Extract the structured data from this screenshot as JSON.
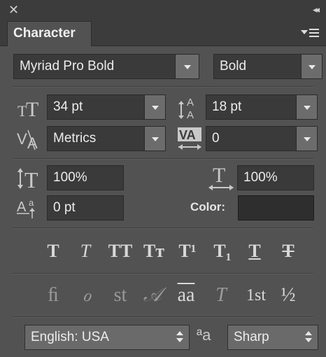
{
  "window": {
    "close_glyph": "✕",
    "collapse_glyph": "◂◂",
    "tab_title": "Character"
  },
  "font": {
    "family": "Myriad Pro Bold",
    "style": "Bold"
  },
  "size": {
    "font_size": "34 pt",
    "leading": "18 pt",
    "kerning": "Metrics",
    "tracking": "0"
  },
  "scale": {
    "vertical": "100%",
    "horizontal": "100%",
    "baseline_shift": "0 pt",
    "color_label": "Color:",
    "color_value": "#2e2e2e"
  },
  "type_styles": [
    "T",
    "T",
    "TT",
    "Tт",
    "T¹",
    "T₁",
    "T",
    "T"
  ],
  "opentype": [
    "ﬁ",
    "ℴ",
    "st",
    "𝒜",
    "aa",
    "T",
    "1st",
    "½"
  ],
  "language": {
    "value": "English: USA",
    "aa_glyph": "ªa",
    "antialias": "Sharp"
  }
}
